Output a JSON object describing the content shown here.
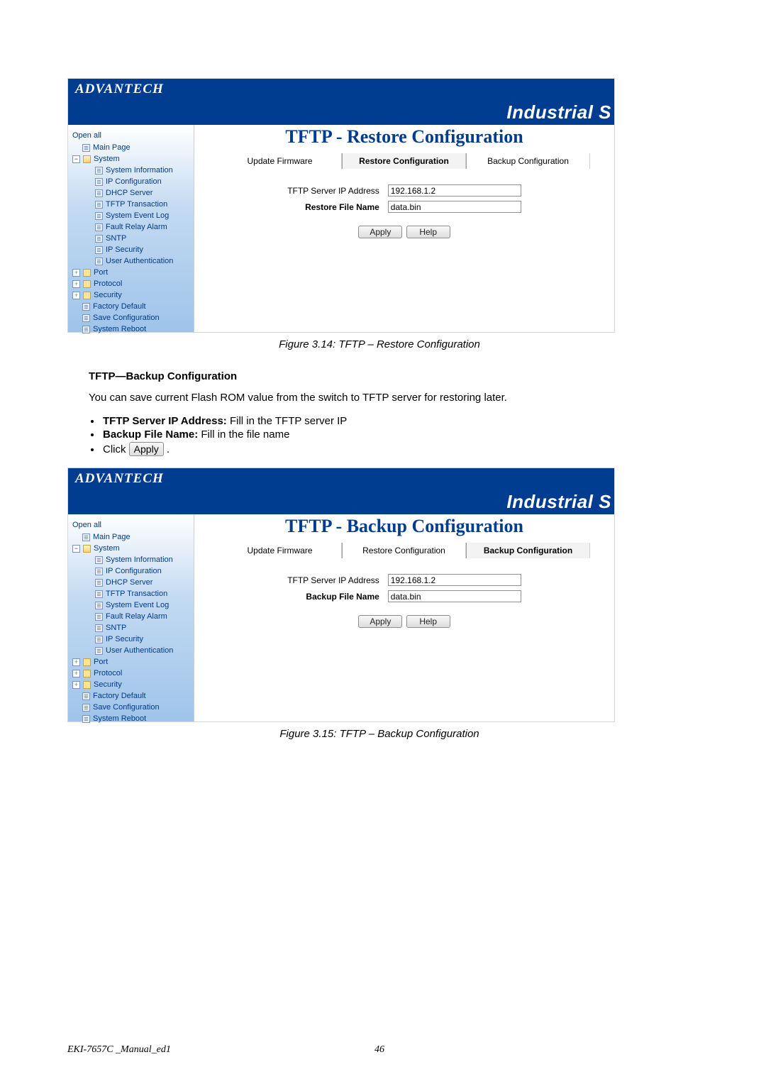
{
  "brand": "ADVANTECH",
  "banner": "Industrial S",
  "tree": {
    "open_all": "Open all",
    "main_page": "Main Page",
    "system": "System",
    "system_children": [
      "System Information",
      "IP Configuration",
      "DHCP Server",
      "TFTP Transaction",
      "System Event Log",
      "Fault Relay Alarm",
      "SNTP",
      "IP Security",
      "User Authentication"
    ],
    "port": "Port",
    "protocol": "Protocol",
    "security": "Security",
    "factory_default": "Factory Default",
    "save_configuration": "Save Configuration",
    "system_reboot": "System Reboot"
  },
  "figures": [
    {
      "pane_title": "TFTP - Restore Configuration",
      "tabs": [
        "Update Firmware",
        "Restore Configuration",
        "Backup Configuration"
      ],
      "active_tab": 1,
      "row1_label": "TFTP Server IP Address",
      "row1_label_bold": false,
      "row1_value": "192.168.1.2",
      "row2_label": "Restore File Name",
      "row2_value": "data.bin",
      "apply": "Apply",
      "help": "Help",
      "caption": "Figure 3.14: TFTP – Restore Configuration"
    },
    {
      "pane_title": "TFTP - Backup Configuration",
      "tabs": [
        "Update Firmware",
        "Restore Configuration",
        "Backup Configuration"
      ],
      "active_tab": 2,
      "row1_label": "TFTP Server IP Address",
      "row1_label_bold": false,
      "row1_value": "192.168.1.2",
      "row2_label": "Backup File Name",
      "row2_value": "data.bin",
      "apply": "Apply",
      "help": "Help",
      "caption": "Figure 3.15: TFTP – Backup Configuration"
    }
  ],
  "doc": {
    "heading": "TFTP—Backup Configuration",
    "body": "You can save current Flash ROM value from the switch to TFTP server for restoring later.",
    "bullets": [
      {
        "bold": "TFTP Server IP Address:",
        "rest": " Fill in the TFTP server IP"
      },
      {
        "bold": "Backup File Name:",
        "rest": " Fill in the file name"
      }
    ],
    "click_word": "Click ",
    "apply_label": "Apply",
    "period": " ."
  },
  "footer": {
    "left": "EKI-7657C _Manual_ed1",
    "page": "46"
  }
}
